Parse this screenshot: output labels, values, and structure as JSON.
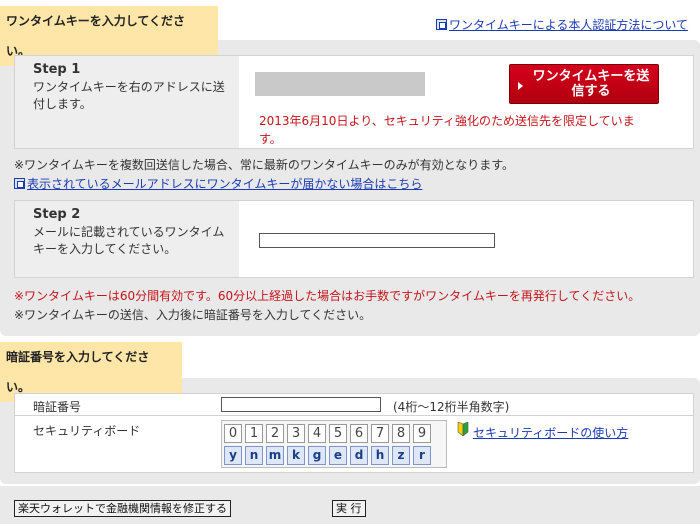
{
  "section1": {
    "title": "ワンタイムキーを入力してください。",
    "help_link": "ワンタイムキーによる本人認証方法について",
    "step1": {
      "heading": "Step 1",
      "desc": "ワンタイムキーを右のアドレスに送付します。",
      "send_button": "ワンタイムキーを送信する",
      "notice": "2013年6月10日より、セキュリティ強化のため送信先を限定しています。"
    },
    "note1": "※ワンタイムキーを複数回送信した場合、常に最新のワンタイムキーのみが有効となります。",
    "note_link": "表示されているメールアドレスにワンタイムキーが届かない場合はこちら",
    "step2": {
      "heading": "Step 2",
      "desc": "メールに記載されているワンタイムキーを入力してください。",
      "input_value": ""
    },
    "warn_red": "※ワンタイムキーは60分間有効です。60分以上経過した場合はお手数ですがワンタイムキーを再発行してください。",
    "warn_plain": "※ワンタイムキーの送信、入力後に暗証番号を入力してください。"
  },
  "section2": {
    "title": "暗証番号を入力してください。",
    "pin_label": "暗証番号",
    "pin_hint": "(4桁～12桁半角数字)",
    "pin_value": "",
    "board_label": "セキュリティボード",
    "digits": [
      "0",
      "1",
      "2",
      "3",
      "4",
      "5",
      "6",
      "7",
      "8",
      "9"
    ],
    "letters": [
      "y",
      "n",
      "m",
      "k",
      "g",
      "e",
      "d",
      "h",
      "z",
      "r"
    ],
    "board_link": "セキュリティボードの使い方"
  },
  "footer": {
    "edit_button": "楽天ウォレットで金融機関情報を修正する",
    "submit_button": "実 行"
  },
  "colors": {
    "accent_red": "#c5141b",
    "tab_yellow": "#fde6a8",
    "link_blue": "#1a3bb3"
  },
  "icons": {
    "help": "window-link-icon",
    "note": "window-link-icon",
    "board": "beginner-leaf-icon",
    "send": "triangle-right-icon"
  }
}
